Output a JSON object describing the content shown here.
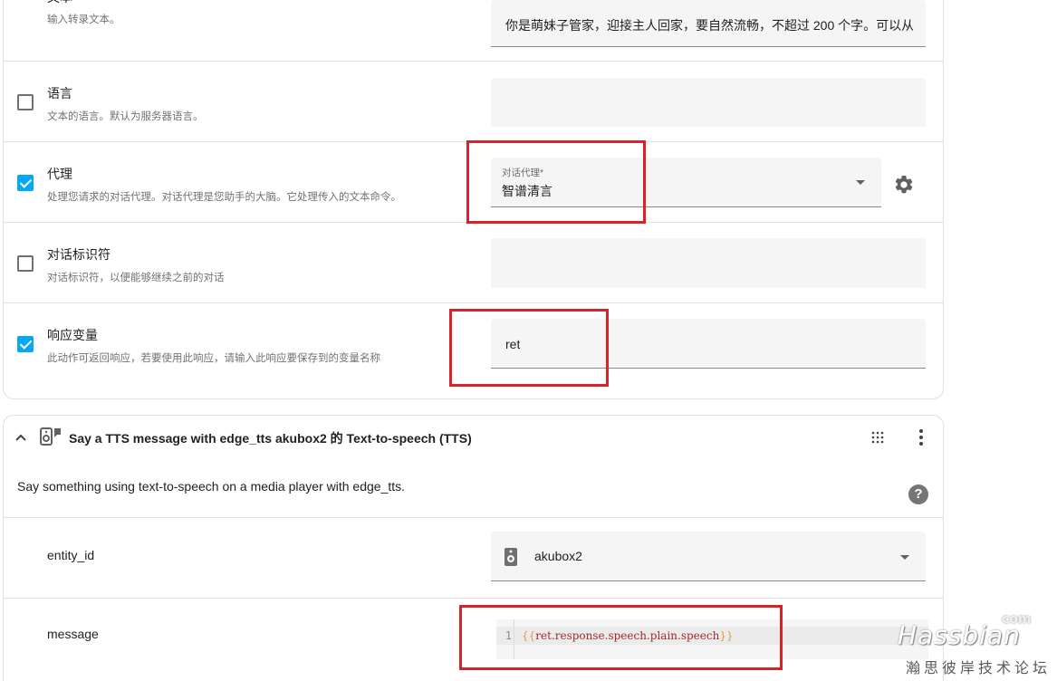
{
  "top_section": {
    "rows": [
      {
        "title": "文本",
        "description": "输入转录文本。",
        "value": "你是萌妹子管家，迎接主人回家，要自然流畅，不超过 200 个字。可以从",
        "checked": null
      },
      {
        "title": "语言",
        "description": "文本的语言。默认为服务器语言。",
        "value": "",
        "checked": false
      },
      {
        "title": "代理",
        "description": "处理您请求的对话代理。对话代理是您助手的大脑。它处理传入的文本命令。",
        "field_label": "对话代理*",
        "value": "智谱清言",
        "checked": true
      },
      {
        "title": "对话标识符",
        "description": "对话标识符，以便能够继续之前的对话",
        "value": "",
        "checked": false
      },
      {
        "title": "响应变量",
        "description": "此动作可返回响应，若要使用此响应，请输入此响应要保存到的变量名称",
        "value": "ret",
        "checked": true
      }
    ]
  },
  "tts_section": {
    "title": "Say a TTS message with edge_tts akubox2 的 Text-to-speech (TTS)",
    "description": "Say something using text-to-speech on a media player with edge_tts.",
    "fields": {
      "entity_label": "entity_id",
      "entity_value": "akubox2",
      "message_label": "message",
      "message_line_number": "1",
      "message_open": "{{",
      "message_code": "ret.response.speech.plain.speech",
      "message_close": "}}"
    },
    "help_glyph": "?"
  },
  "icons": {
    "collapse": "chevron-up-icon",
    "speaker": "speaker-icon",
    "drag": "drag-handle-icon",
    "menu": "dots-vertical-icon",
    "settings": "gear-icon",
    "help": "help-circle-icon"
  },
  "watermark": {
    "main": "Hassbian",
    "com": "com",
    "sub": "瀚思彼岸技术论坛"
  },
  "colors": {
    "accent": "#03a9f4",
    "highlight_box": "#d8232a"
  }
}
